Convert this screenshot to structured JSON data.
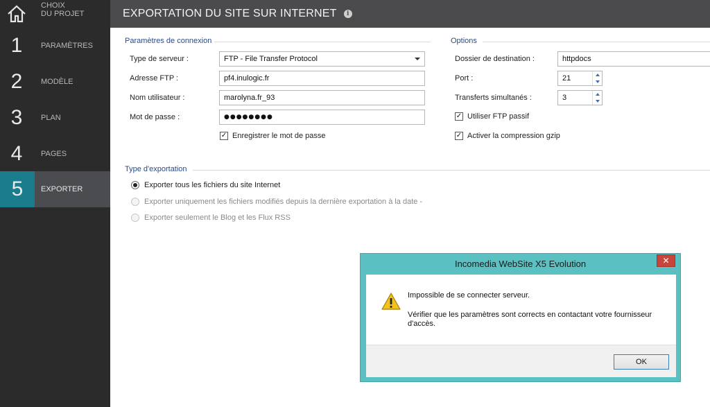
{
  "sidebar": {
    "home": {
      "icon": "home-icon",
      "label_line1": "CHOIX",
      "label_line2": "DU PROJET"
    },
    "items": [
      {
        "num": "1",
        "label": "PARAMÈTRES"
      },
      {
        "num": "2",
        "label": "MODÈLE"
      },
      {
        "num": "3",
        "label": "PLAN"
      },
      {
        "num": "4",
        "label": "PAGES"
      },
      {
        "num": "5",
        "label": "EXPORTER",
        "active": true
      }
    ]
  },
  "header": {
    "title": "EXPORTATION DU SITE SUR INTERNET",
    "info_icon": "info-icon"
  },
  "connection": {
    "section_title": "Paramètres de connexion",
    "server_type_label": "Type de serveur :",
    "server_type_value": "FTP - File Transfer Protocol",
    "ftp_address_label": "Adresse FTP :",
    "ftp_address_value": "pf4.inulogic.fr",
    "username_label": "Nom utilisateur :",
    "username_value": "marolyna.fr_93",
    "password_label": "Mot de passe :",
    "password_value": "●●●●●●●●",
    "save_password_label": "Enregistrer le mot de passe",
    "save_password_checked": true
  },
  "options": {
    "section_title": "Options",
    "destination_label": "Dossier de destination :",
    "destination_value": "httpdocs",
    "port_label": "Port :",
    "port_value": "21",
    "simultaneous_label": "Transferts simultanés :",
    "simultaneous_value": "3",
    "passive_ftp_label": "Utiliser FTP passif",
    "passive_ftp_checked": true,
    "gzip_label": "Activer la compression gzip",
    "gzip_checked": true
  },
  "export_type": {
    "section_title": "Type d'exportation",
    "options": [
      {
        "label": "Exporter tous les fichiers du site Internet",
        "checked": true,
        "disabled": false
      },
      {
        "label": "Exporter uniquement les fichiers modifiés depuis la dernière exportation à la date -",
        "checked": false,
        "disabled": true
      },
      {
        "label": "Exporter seulement le Blog et les Flux RSS",
        "checked": false,
        "disabled": true
      }
    ]
  },
  "dialog": {
    "title": "Incomedia WebSite X5 Evolution",
    "close_glyph": "✕",
    "message1": "Impossible de se connecter serveur.",
    "message2": "Vérifier que les paramètres sont corrects en contactant votre fournisseur d'accès.",
    "ok_label": "OK",
    "icon": "warning-icon"
  },
  "colors": {
    "sidebar_bg": "#2b2b2b",
    "active_accent": "#1a7c8c",
    "header_bg": "#4b4b4d",
    "section_title": "#2a4a8a",
    "dialog_frame": "#5bc0c1",
    "close_button": "#c7453d"
  }
}
